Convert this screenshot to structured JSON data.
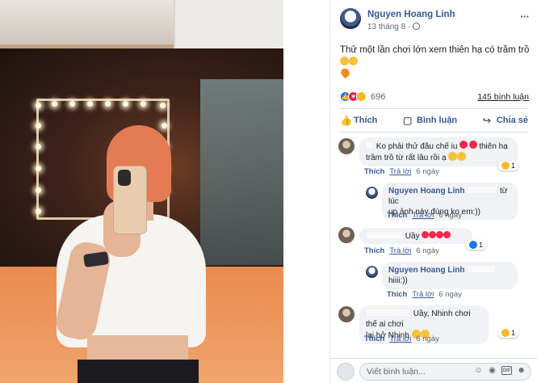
{
  "post": {
    "author": "Nguyen Hoang Linh",
    "date": "13 tháng 8 ·",
    "caption_text": "Thử một lần chơi lớn xem thiên hạ có trầm trồ",
    "more_label": "···",
    "reaction_count": "696",
    "comment_count": "145 bình luận"
  },
  "actions": {
    "like": "Thích",
    "comment": "Bình luận",
    "share": "Chia sẻ"
  },
  "comments": [
    {
      "text": "Ko phải thử đâu chế iu",
      "text_cont": "thiên hạ trầm trồ từ rất lâu rồi ạ",
      "like": "Thích",
      "reply": "Trả lời",
      "age": "6 ngày",
      "badge_count": "1"
    },
    {
      "name": "Nguyen Hoang Linh",
      "text_tail": "từ lúc",
      "text_cont": "up ảnh này đúng ko em:))",
      "like": "Thích",
      "reply": "Trả lời",
      "age": "6 ngày"
    },
    {
      "text": "Uầy",
      "like": "Thích",
      "reply": "Trả lời",
      "age": "6 ngày",
      "badge_count": "1"
    },
    {
      "name": "Nguyen Hoang Linh",
      "text": "hiiii:))",
      "like": "Thích",
      "reply": "Trả lời",
      "age": "6 ngày"
    },
    {
      "text": "Uầy, Nhinh chơi thế ai chơi",
      "text_cont": "lại hở Nhinh",
      "like": "Thích",
      "reply": "Trả lời",
      "age": "6 ngày",
      "badge_count": "1"
    }
  ],
  "composer": {
    "placeholder": "Viết bình luận..."
  },
  "colors": {
    "link": "#385898",
    "like_blue": "#1877f2",
    "love_red": "#f0284a",
    "wow_yellow": "#f7b928"
  }
}
